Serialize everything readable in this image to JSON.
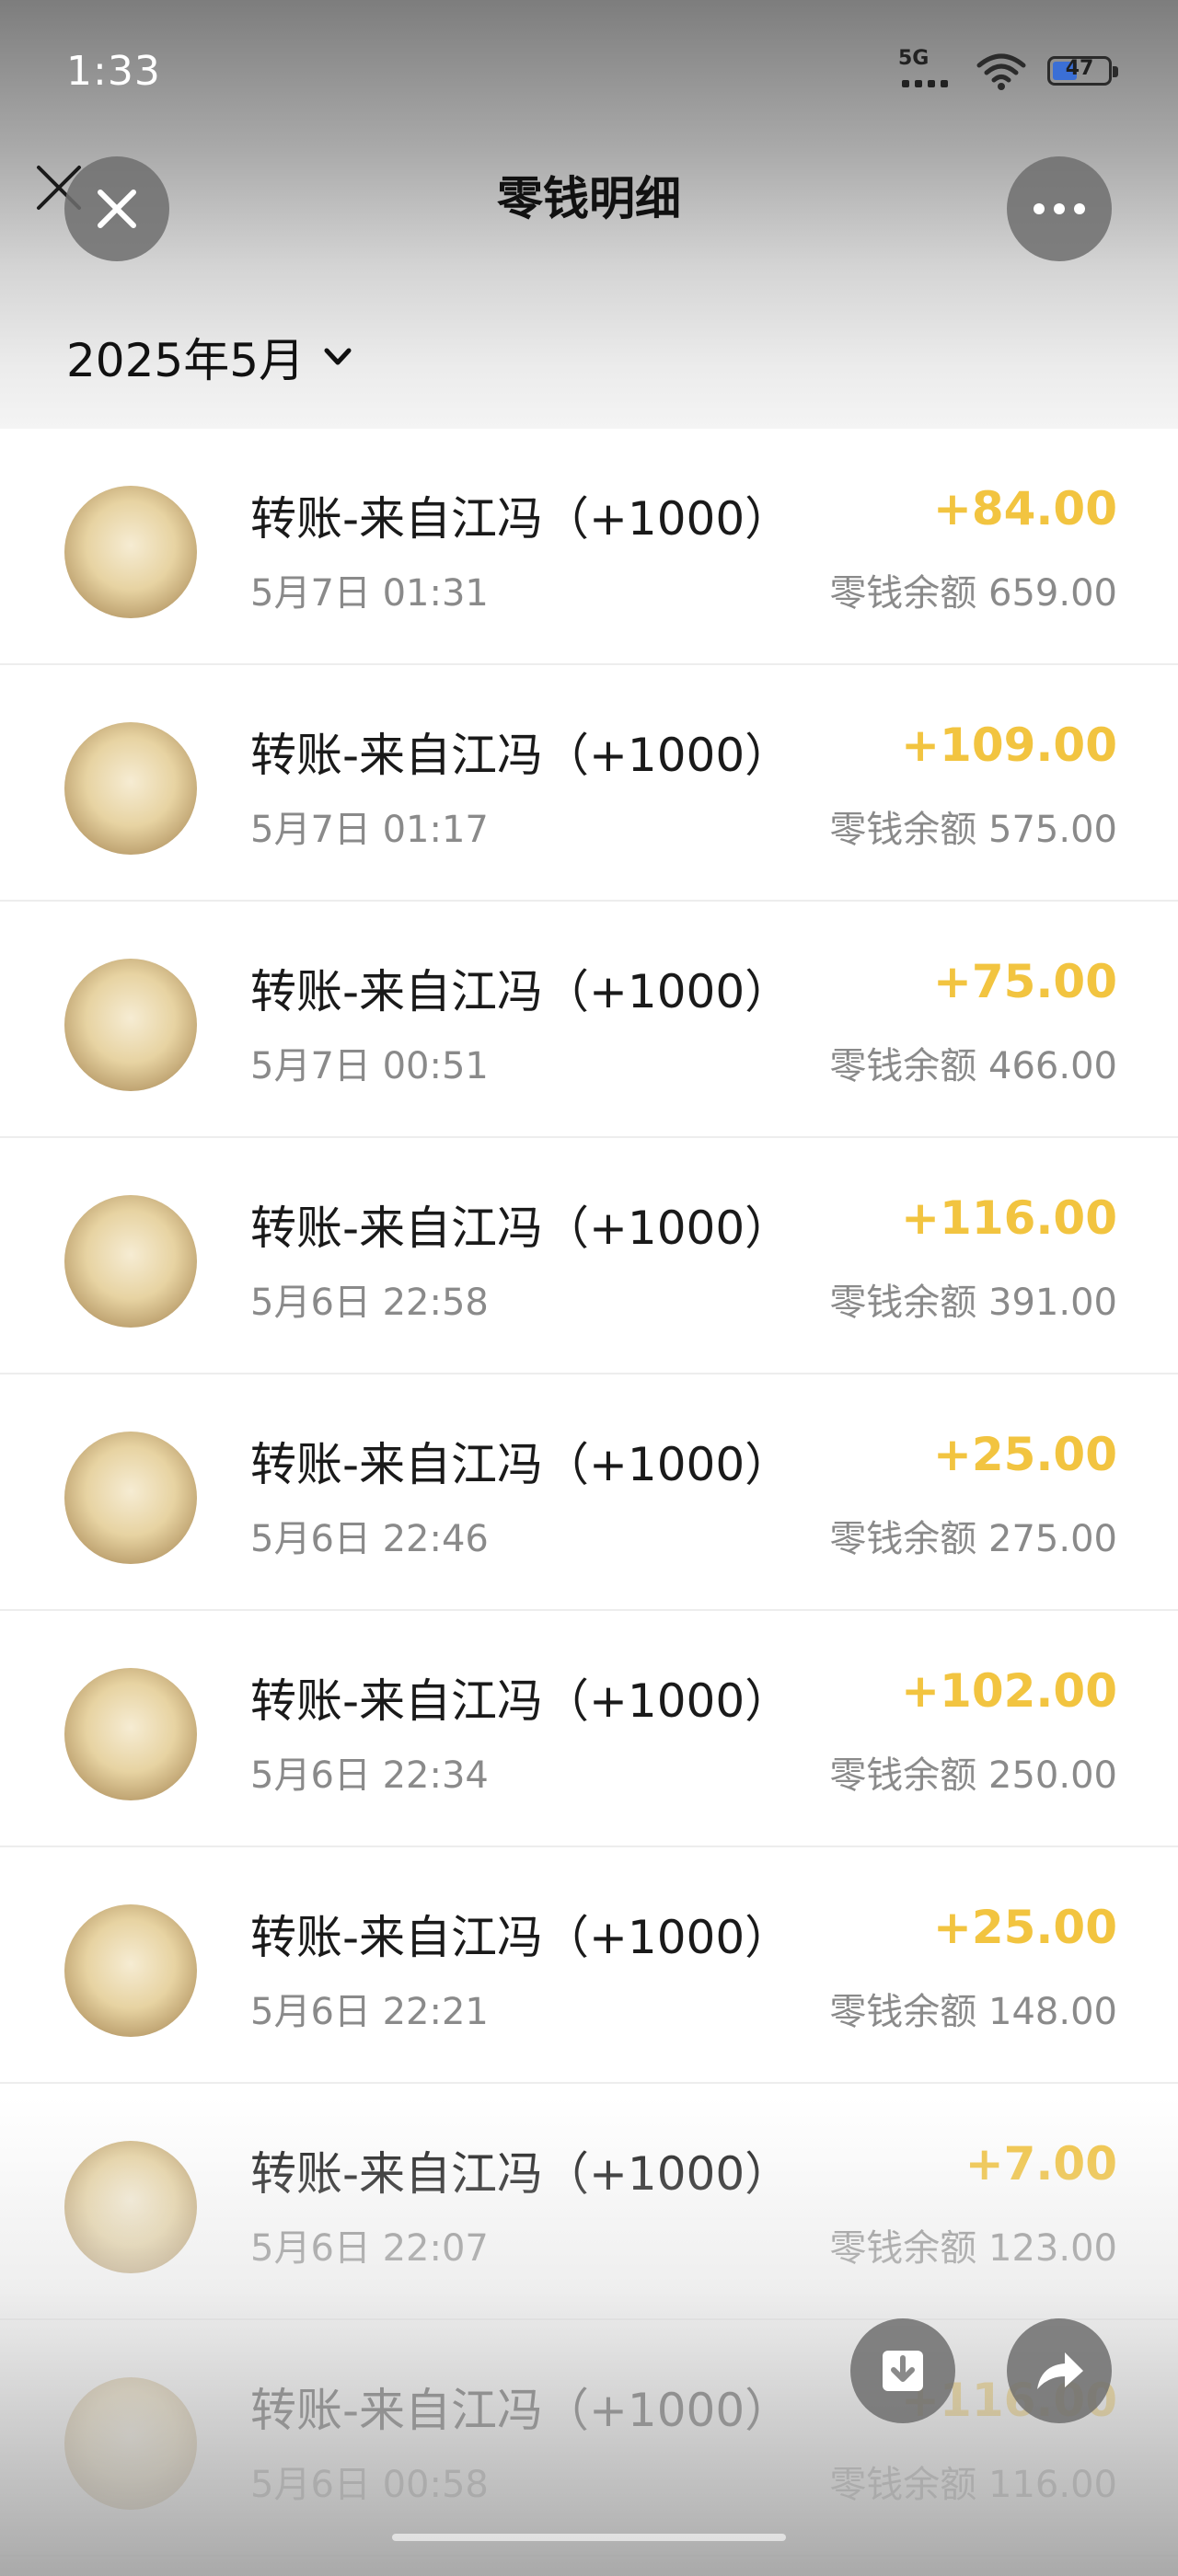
{
  "status_bar": {
    "time": "1:33",
    "network": "5G",
    "battery": "47"
  },
  "header": {
    "title": "零钱明细",
    "month": "2025年5月"
  },
  "icons": {
    "back": "close-x-icon",
    "close": "close-icon",
    "more": "more-dots-icon",
    "month_dropdown": "chevron-down-icon",
    "download": "download-icon",
    "share": "share-arrow-icon"
  },
  "colors": {
    "amount": "#f2c440",
    "secondary_text": "#8a8a8a"
  },
  "transactions": [
    {
      "title": "转账-来自江冯（+1000）",
      "time": "5月7日 01:31",
      "amount": "+84.00",
      "balance": "零钱余额 659.00"
    },
    {
      "title": "转账-来自江冯（+1000）",
      "time": "5月7日 01:17",
      "amount": "+109.00",
      "balance": "零钱余额 575.00"
    },
    {
      "title": "转账-来自江冯（+1000）",
      "time": "5月7日 00:51",
      "amount": "+75.00",
      "balance": "零钱余额 466.00"
    },
    {
      "title": "转账-来自江冯（+1000）",
      "time": "5月6日 22:58",
      "amount": "+116.00",
      "balance": "零钱余额 391.00"
    },
    {
      "title": "转账-来自江冯（+1000）",
      "time": "5月6日 22:46",
      "amount": "+25.00",
      "balance": "零钱余额 275.00"
    },
    {
      "title": "转账-来自江冯（+1000）",
      "time": "5月6日 22:34",
      "amount": "+102.00",
      "balance": "零钱余额 250.00"
    },
    {
      "title": "转账-来自江冯（+1000）",
      "time": "5月6日 22:21",
      "amount": "+25.00",
      "balance": "零钱余额 148.00"
    },
    {
      "title": "转账-来自江冯（+1000）",
      "time": "5月6日 22:07",
      "amount": "+7.00",
      "balance": "零钱余额 123.00"
    },
    {
      "title": "转账-来自江冯（+1000）",
      "time": "5月6日 00:58",
      "amount": "+116.00",
      "balance": "零钱余额 116.00"
    }
  ]
}
